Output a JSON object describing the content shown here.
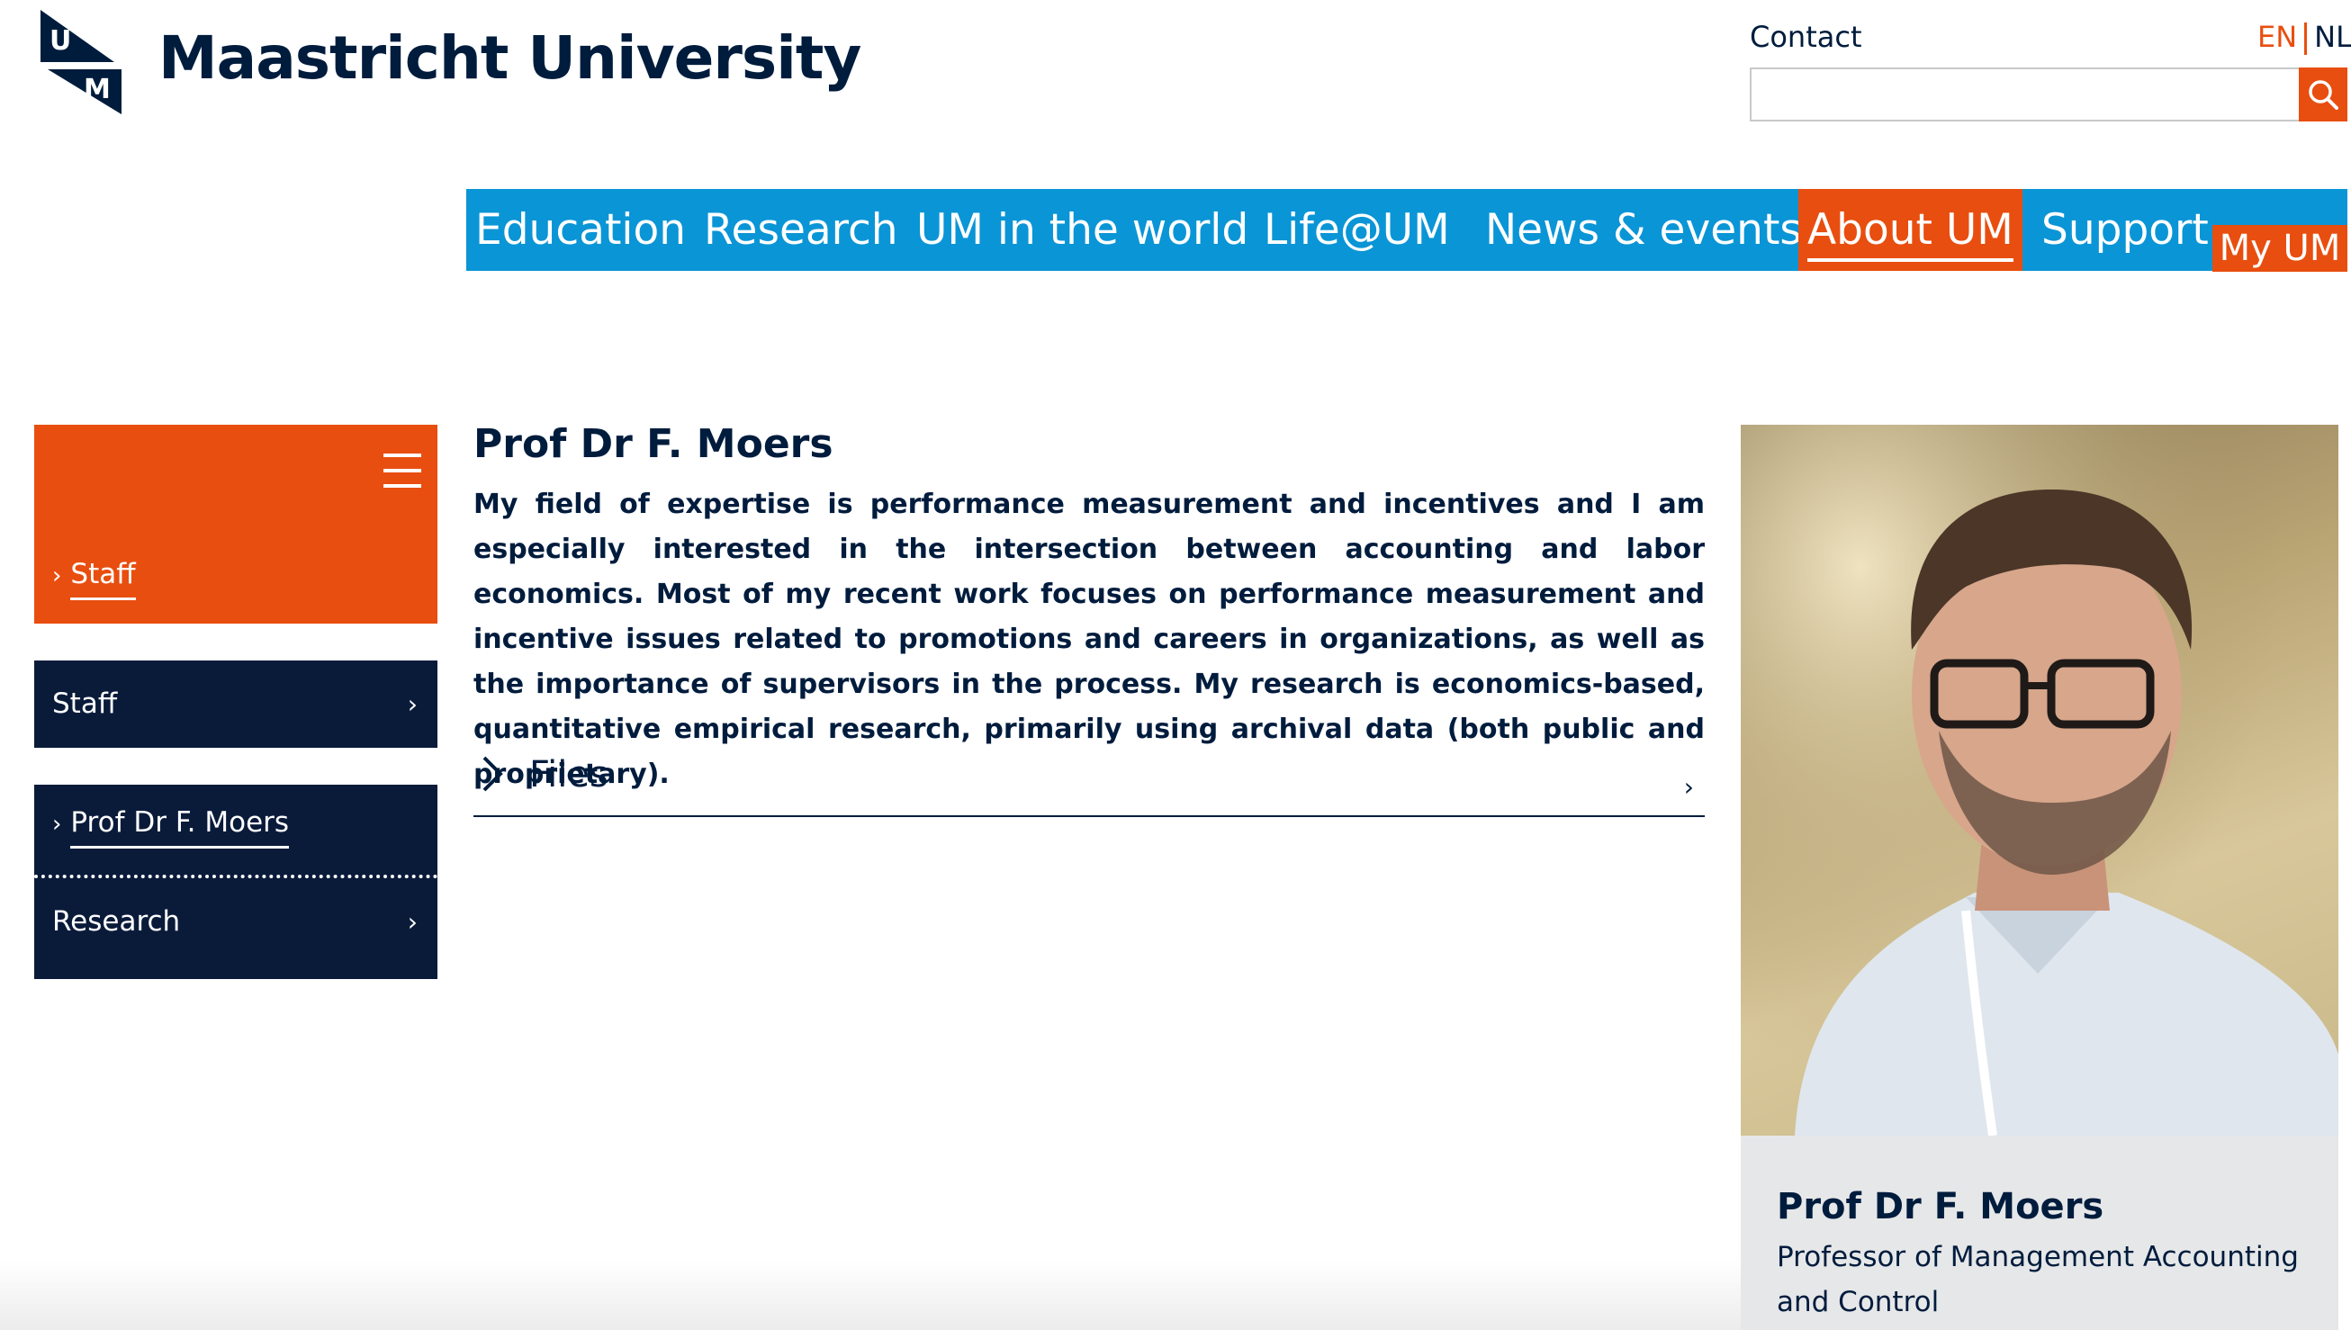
{
  "header": {
    "title": "Maastricht University",
    "logo_letter_u": "U",
    "logo_letter_m": "M",
    "contact": "Contact",
    "lang_active": "EN",
    "lang_other": "NL",
    "search_value": ""
  },
  "nav": {
    "items": [
      "Education",
      "Research",
      "UM in the world",
      "Life@UM",
      "News & events",
      "About UM",
      "Support"
    ],
    "active": "About UM",
    "my_um": "My UM"
  },
  "sidebar": {
    "top_link": "Staff",
    "section_label": "Staff",
    "current_item": "Prof Dr F. Moers",
    "sub_item": "Research"
  },
  "profile": {
    "name": "Prof Dr F. Moers",
    "bio": "My field of expertise is performance measurement and incentives and I am especially interested in the intersection between accounting and labor economics. Most of my recent work focuses on performance measurement and incentive issues related to promotions and careers in organizations, as well as the importance of supervisors in the process. My research is economics-based, quantitative empirical research, primarily using archival data (both public and proprietary).",
    "files_label": "Files"
  },
  "card": {
    "name": "Prof Dr F. Moers",
    "role": "Professor of Management Accounting and Control"
  },
  "colors": {
    "navy": "#001c3d",
    "accent_orange": "#e84e0f",
    "nav_blue": "#0a95d6",
    "sidebar_dark": "#0a1b3a"
  },
  "icons": {
    "search": "search-icon",
    "menu": "hamburger-icon",
    "chevron": "chevron-right-icon"
  }
}
